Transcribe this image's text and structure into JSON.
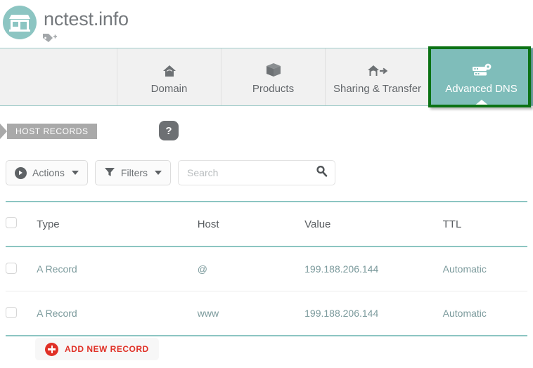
{
  "header": {
    "domain_title": "nctest.info",
    "avatar_icon": "storefront-icon",
    "tag_icon": "add-tag-icon"
  },
  "tabs": [
    {
      "label": "Domain",
      "icon": "house-icon",
      "active": false
    },
    {
      "label": "Products",
      "icon": "box-icon",
      "active": false
    },
    {
      "label": "Sharing & Transfer",
      "icon": "house-arrow-icon",
      "active": false
    },
    {
      "label": "Advanced DNS",
      "icon": "server-gear-icon",
      "active": true
    }
  ],
  "section": {
    "ribbon_label": "HOST RECORDS",
    "help_label": "?"
  },
  "toolbar": {
    "actions_label": "Actions",
    "actions_icon": "play-circle-icon",
    "filters_label": "Filters",
    "filters_icon": "funnel-icon",
    "search_placeholder": "Search",
    "search_value": "",
    "search_icon": "search-icon"
  },
  "table": {
    "columns": [
      "Type",
      "Host",
      "Value",
      "TTL"
    ],
    "rows": [
      {
        "type": "A Record",
        "host": "@",
        "value": "199.188.206.144",
        "ttl": "Automatic"
      },
      {
        "type": "A Record",
        "host": "www",
        "value": "199.188.206.144",
        "ttl": "Automatic"
      }
    ]
  },
  "footer": {
    "add_record_label": "ADD NEW RECORD",
    "add_record_icon": "plus-circle-icon"
  },
  "colors": {
    "teal": "#7fbdba",
    "teal_border": "#8cc5c2",
    "highlight_green": "#0b7214",
    "accent_red": "#e03127",
    "tab_bg": "#f1f1f1",
    "ribbon_gray": "#a9a9a9"
  }
}
